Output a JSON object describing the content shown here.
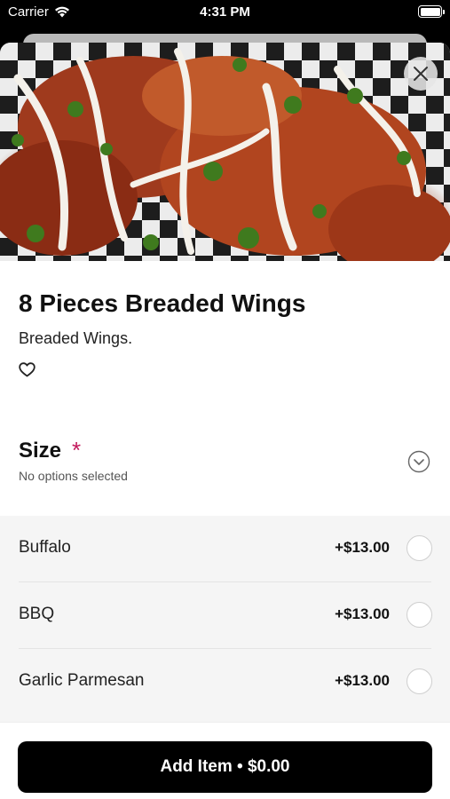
{
  "status_bar": {
    "carrier": "Carrier",
    "time": "4:31 PM"
  },
  "item": {
    "title": "8 Pieces Breaded Wings",
    "description": "Breaded Wings."
  },
  "size_section": {
    "label": "Size",
    "required_mark": "*",
    "selection_status": "No options selected"
  },
  "options": [
    {
      "name": "Buffalo",
      "price": "+$13.00"
    },
    {
      "name": "BBQ",
      "price": "+$13.00"
    },
    {
      "name": "Garlic Parmesan",
      "price": "+$13.00"
    }
  ],
  "add_button": {
    "label": "Add Item • $0.00"
  },
  "colors": {
    "required": "#c2185b",
    "button": "#000000"
  },
  "icons": [
    "wifi-icon",
    "battery-icon",
    "close-icon",
    "heart-icon",
    "chevron-down-icon"
  ]
}
